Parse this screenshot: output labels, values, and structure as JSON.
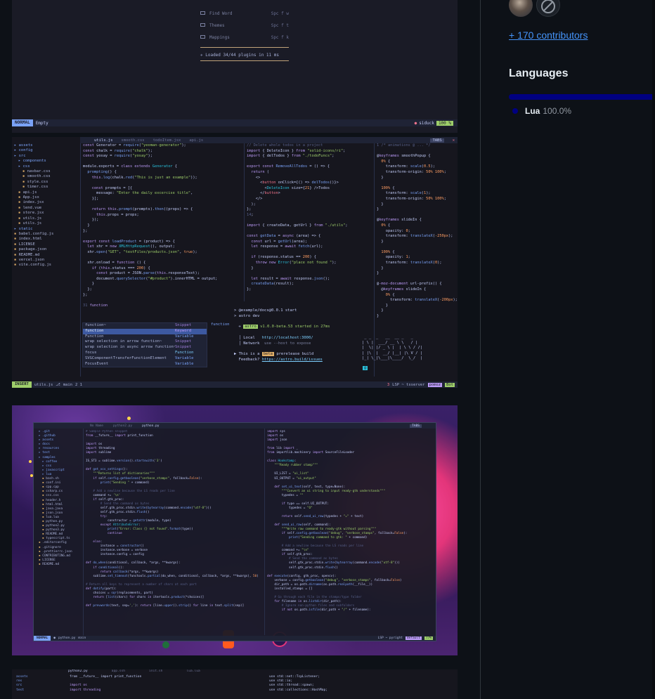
{
  "dashboard": {
    "items": [
      {
        "label": "Find Word",
        "key": "Spc f w"
      },
      {
        "label": "Themes",
        "key": "Spc f t"
      },
      {
        "label": "Mappings",
        "key": "Spc f k"
      }
    ],
    "loaded": "Loaded 34/44 plugins in 11 ms",
    "statusline": {
      "mode": "NORMAL",
      "file": "Empty",
      "user": "siduck",
      "percent": "100 %"
    }
  },
  "editor": {
    "tabs": [
      "utils.js",
      "smooth.css",
      "todoItem.jsx",
      "api.js"
    ],
    "tabs_indicator": "TABS",
    "tree": [
      {
        "name": "assets",
        "dir": true,
        "depth": 0
      },
      {
        "name": "config",
        "dir": true,
        "depth": 0
      },
      {
        "name": "src",
        "dir": true,
        "depth": 0
      },
      {
        "name": "components",
        "dir": true,
        "depth": 1
      },
      {
        "name": "css",
        "dir": true,
        "depth": 1
      },
      {
        "name": "navbar.css",
        "dir": false,
        "depth": 2
      },
      {
        "name": "smooth.css",
        "dir": false,
        "depth": 2
      },
      {
        "name": "style.css",
        "dir": false,
        "depth": 2
      },
      {
        "name": "timer.css",
        "dir": false,
        "depth": 2
      },
      {
        "name": "api.js",
        "dir": false,
        "depth": 1
      },
      {
        "name": "App.jsx",
        "dir": false,
        "depth": 1
      },
      {
        "name": "index.jsx",
        "dir": false,
        "depth": 1
      },
      {
        "name": "lend.vue",
        "dir": false,
        "depth": 1
      },
      {
        "name": "store.jsx",
        "dir": false,
        "depth": 1
      },
      {
        "name": "utils.js",
        "dir": false,
        "depth": 1
      },
      {
        "name": "utils.js",
        "dir": false,
        "depth": 1
      },
      {
        "name": "static",
        "dir": true,
        "depth": 0
      },
      {
        "name": "babel.config.js",
        "dir": false,
        "depth": 0
      },
      {
        "name": "index.html",
        "dir": false,
        "depth": 0
      },
      {
        "name": "LICENSE",
        "dir": false,
        "depth": 0
      },
      {
        "name": "package.json",
        "dir": false,
        "depth": 0
      },
      {
        "name": "README.md",
        "dir": false,
        "depth": 0
      },
      {
        "name": "vercel.json",
        "dir": false,
        "depth": 0
      },
      {
        "name": "vite.config.js",
        "dir": false,
        "depth": 0
      }
    ],
    "completion": {
      "items": [
        {
          "text": "function~",
          "kind": "Snippet"
        },
        {
          "text": "function",
          "kind": "Keyword"
        },
        {
          "text": "Function",
          "kind": "Variable"
        },
        {
          "text": "wrap selection in arrow function~",
          "kind": "Snippet"
        },
        {
          "text": "wrap selection in async arrow function~",
          "kind": "Snippet"
        },
        {
          "text": "focus",
          "kind": "Function"
        },
        {
          "text": "SVGComponentTransferFunctionElement",
          "kind": "Variable"
        },
        {
          "text": "FocusEvent",
          "kind": "Variable"
        }
      ],
      "doc": "function"
    },
    "terminal": {
      "prompt1": "> @example/docs@0.0.1 start",
      "prompt2": "> astro dev",
      "astro_badge": "astro",
      "astro_msg": "v1.0.0-beta.53 started in 27ms",
      "local_label": "Local",
      "local_url": "http://localhost:3000/",
      "network_label": "Network",
      "network_msg": "use --host to expose",
      "beta_pre": "This is a",
      "beta_badge": "beta",
      "beta_post": "prerelease build",
      "feedback_label": "Feedback?",
      "feedback_url": "https://astro.build/issues"
    },
    "statusline": {
      "mode": "INSERT",
      "file": "utils.js",
      "branch": "main",
      "diag": "2  1",
      "errors": "3",
      "lsp": "LSP ~ tsserver",
      "user": "pomoz",
      "mode2": "Bot"
    }
  },
  "wallpaper_editor": {
    "tabs": [
      "No Name",
      "python2.py",
      "python.py"
    ],
    "tabs_indicator": "TABS",
    "tree": [
      {
        "name": ".git",
        "dir": true,
        "depth": 0
      },
      {
        "name": ".github",
        "dir": true,
        "depth": 0
      },
      {
        "name": "assets",
        "dir": true,
        "depth": 0
      },
      {
        "name": "docs",
        "dir": true,
        "depth": 0
      },
      {
        "name": "resources",
        "dir": true,
        "depth": 0
      },
      {
        "name": "test",
        "dir": true,
        "depth": 0
      },
      {
        "name": "samples",
        "dir": true,
        "depth": 0
      },
      {
        "name": "coffee",
        "dir": true,
        "depth": 1
      },
      {
        "name": "css",
        "dir": true,
        "depth": 1
      },
      {
        "name": "javascript",
        "dir": true,
        "depth": 1
      },
      {
        "name": "lua",
        "dir": true,
        "depth": 1
      },
      {
        "name": "bash.sh",
        "dir": false,
        "depth": 1
      },
      {
        "name": "conf.ini",
        "dir": false,
        "depth": 1
      },
      {
        "name": "cpp.cpp",
        "dir": false,
        "depth": 1
      },
      {
        "name": "csharp.cs",
        "dir": false,
        "depth": 1
      },
      {
        "name": "css.css",
        "dir": false,
        "depth": 1
      },
      {
        "name": "header.h",
        "dir": false,
        "depth": 1
      },
      {
        "name": "html.html",
        "dir": false,
        "depth": 1
      },
      {
        "name": "java.java",
        "dir": false,
        "depth": 1
      },
      {
        "name": "json.json",
        "dir": false,
        "depth": 1
      },
      {
        "name": "lua.lua",
        "dir": false,
        "depth": 1
      },
      {
        "name": "python.py",
        "dir": false,
        "depth": 1
      },
      {
        "name": "python2.py",
        "dir": false,
        "depth": 1
      },
      {
        "name": "python3.py",
        "dir": false,
        "depth": 1
      },
      {
        "name": "README.md",
        "dir": false,
        "depth": 1
      },
      {
        "name": "typescript.ts",
        "dir": false,
        "depth": 1
      },
      {
        "name": ".editorconfig",
        "dir": false,
        "depth": 0
      },
      {
        "name": ".gitignore",
        "dir": false,
        "depth": 0
      },
      {
        "name": ".prettierrc.json",
        "dir": false,
        "depth": 0
      },
      {
        "name": "CONTRIBUTING.md",
        "dir": false,
        "depth": 0
      },
      {
        "name": "LICENSE",
        "dir": false,
        "depth": 0
      },
      {
        "name": "README.md",
        "dir": false,
        "depth": 0
      }
    ],
    "statusline": {
      "mode": "NORMAL",
      "file": "python.py",
      "branch": "main",
      "lsp": "LSP ~ pyright",
      "user": "default",
      "percent": "77%"
    }
  },
  "partial": {
    "tree": [
      "assets",
      "res",
      "src",
      "test"
    ],
    "tabs": [
      "python2.py",
      "app.ssh",
      "init.sh",
      "lua.lua"
    ],
    "left_code": [
      "from __future__ import print_function",
      "",
      "import os",
      "import threading"
    ],
    "right_code": [
      "use std::net::TcpListener;",
      "use std::io;",
      "use std::thread::spawn;",
      "use std::collections::HashMap;"
    ]
  },
  "sidebar": {
    "contributors_link": "+ 170 contributors",
    "languages_title": "Languages",
    "languages": [
      {
        "name": "Lua",
        "percent": "100.0%",
        "share": 100,
        "color": "#000080"
      }
    ]
  },
  "colors": {
    "background": "#0d1117",
    "link": "#4493f8",
    "lua": "#000080"
  }
}
